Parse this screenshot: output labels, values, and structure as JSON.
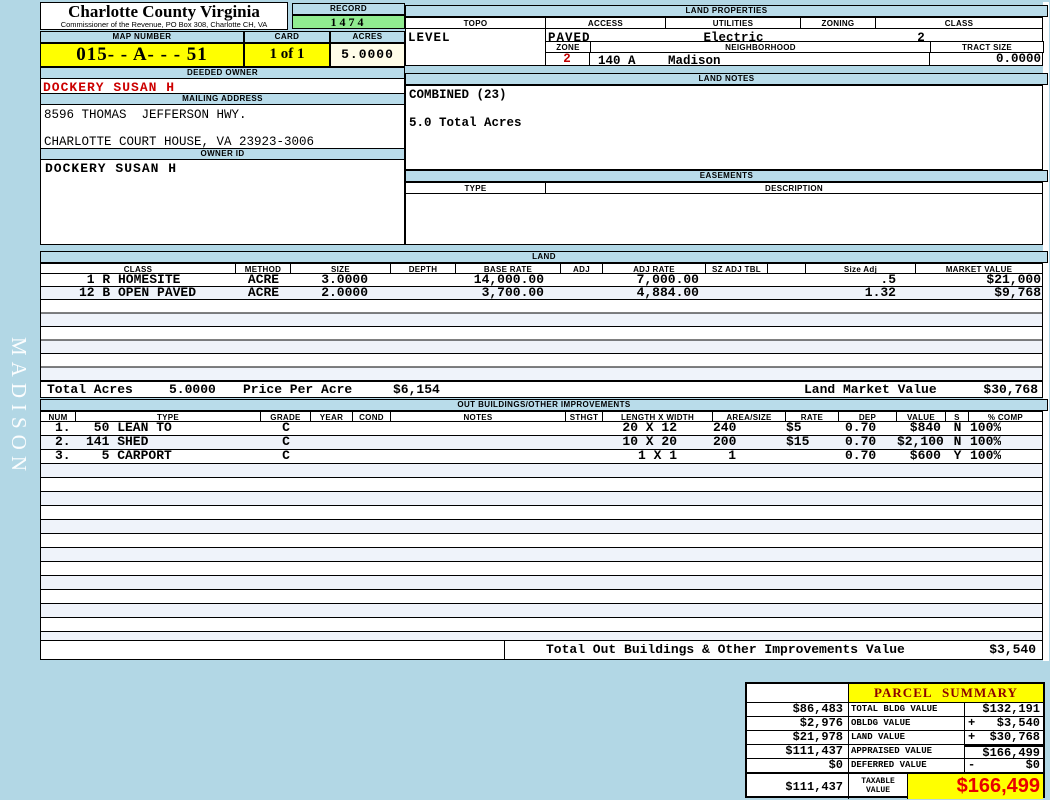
{
  "sidebar": {
    "district": "MADISON"
  },
  "header": {
    "title": "Charlotte County Virginia",
    "subtitle": "Commissioner of the Revenue, PO Box 308, Charlotte CH, VA",
    "record_label": "RECORD",
    "record_value": "1474",
    "map_number_label": "MAP NUMBER",
    "map_number_value": "015- - A- - - 51",
    "card_label": "CARD",
    "card_value": "1 of 1",
    "acres_label": "ACRES",
    "acres_value": "5.0000"
  },
  "owner": {
    "deeded_owner_label": "DEEDED OWNER",
    "deeded_owner": "DOCKERY SUSAN H",
    "mailing_address_label": "MAILING ADDRESS",
    "address_line1": "8596 THOMAS  JEFFERSON HWY.",
    "address_line2": "CHARLOTTE COURT HOUSE, VA 23923-3006",
    "owner_id_label": "OWNER ID",
    "owner_id": "DOCKERY SUSAN H"
  },
  "land_properties": {
    "title": "LAND PROPERTIES",
    "topo_label": "TOPO",
    "topo": "LEVEL",
    "access_label": "ACCESS",
    "access": "PAVED",
    "utilities_label": "UTILITIES",
    "utilities": "Electric",
    "zoning_label": "ZONING",
    "zoning": "",
    "class_label": "CLASS",
    "class": "2",
    "zone_label": "ZONE",
    "zone": "2",
    "neighborhood_label": "NEIGHBORHOOD",
    "neighborhood_code": "140 A",
    "neighborhood_name": "Madison",
    "tract_size_label": "TRACT SIZE",
    "tract_size": "0.0000"
  },
  "land_notes": {
    "title": "LAND NOTES",
    "line1": "COMBINED (23)",
    "line2": "5.0 Total Acres"
  },
  "easements": {
    "title": "EASEMENTS",
    "type_label": "TYPE",
    "description_label": "DESCRIPTION"
  },
  "land": {
    "title": "LAND",
    "headers": {
      "class": "CLASS",
      "method": "METHOD",
      "size": "SIZE",
      "depth": "DEPTH",
      "base_rate": "BASE RATE",
      "adj": "ADJ",
      "adj_rate": "ADJ RATE",
      "sz_adj_tbl": "SZ ADJ TBL",
      "size_adj": "Size Adj",
      "market_value": "MARKET VALUE"
    },
    "rows": [
      {
        "class": " 1 R HOMESITE",
        "method": "ACRE",
        "size": "3.0000",
        "base_rate": "14,000.00",
        "adj_rate": "7,000.00",
        "size_adj": ".5",
        "market_value": "$21,000"
      },
      {
        "class": "12 B OPEN PAVED",
        "method": "ACRE",
        "size": "2.0000",
        "base_rate": "3,700.00",
        "adj_rate": "4,884.00",
        "size_adj": "1.32",
        "market_value": "$9,768"
      }
    ],
    "totals": {
      "total_acres_label": "Total Acres",
      "total_acres": "5.0000",
      "price_per_acre_label": "Price Per Acre",
      "price_per_acre": "$6,154",
      "land_market_value_label": "Land Market Value",
      "land_market_value": "$30,768"
    }
  },
  "outbuildings": {
    "title": "OUT BUILDINGS/OTHER IMPROVEMENTS",
    "headers": {
      "num": "NUM",
      "type": "TYPE",
      "grade": "GRADE",
      "year": "YEAR",
      "cond": "COND",
      "notes": "NOTES",
      "sthgt": "STHGT",
      "length_width": "LENGTH X WIDTH",
      "area_size": "AREA/SIZE",
      "rate": "RATE",
      "dep": "DEP",
      "value": "VALUE",
      "s": "S",
      "pct_comp": "% COMP"
    },
    "rows": [
      {
        "num": "1.",
        "type": " 50 LEAN TO",
        "grade": "C",
        "length_width": "20 X 12",
        "area_size": "240",
        "rate": "$5",
        "dep": "0.70",
        "value": "$840",
        "s": "N",
        "pct_comp": "100%"
      },
      {
        "num": "2.",
        "type": "141 SHED",
        "grade": "C",
        "length_width": "10 X 20",
        "area_size": "200",
        "rate": "$15",
        "dep": "0.70",
        "value": "$2,100",
        "s": "N",
        "pct_comp": "100%"
      },
      {
        "num": "3.",
        "type": "  5 CARPORT",
        "grade": "C",
        "length_width": "1 X 1",
        "area_size": "1",
        "rate": "",
        "dep": "0.70",
        "value": "$600",
        "s": "Y",
        "pct_comp": "100%"
      }
    ],
    "total_label": "Total Out Buildings & Other Improvements Value",
    "total_value": "$3,540"
  },
  "parcel_summary": {
    "title": "PARCEL SUMMARY",
    "rows": [
      {
        "left": "$86,483",
        "label": "TOTAL BLDG VALUE",
        "prefix": "",
        "right": "$132,191"
      },
      {
        "left": "$2,976",
        "label": "OBLDG VALUE",
        "prefix": "+",
        "right": "$3,540"
      },
      {
        "left": "$21,978",
        "label": "LAND VALUE",
        "prefix": "+",
        "right": "$30,768"
      },
      {
        "left": "$111,437",
        "label": "APPRAISED VALUE",
        "prefix": "",
        "right": "$166,499"
      },
      {
        "left": "$0",
        "label": "DEFERRED VALUE",
        "prefix": "-",
        "right": "$0"
      }
    ],
    "taxable": {
      "left": "$111,437",
      "label_line1": "TAXABLE",
      "label_line2": "VALUE",
      "value": "$166,499"
    }
  },
  "colors": {
    "page_blue": "#b2d7e5",
    "band_blue": "#b9dcea",
    "stripe": "#eff3fa",
    "record_green": "#90ec90",
    "accent_yellow": "#ffff00",
    "acres_cream": "#fffde8",
    "owner_red": "#cc0000",
    "zone_red": "#c00000",
    "summary_title_red": "#8b0000",
    "taxable_red": "#e80000"
  }
}
